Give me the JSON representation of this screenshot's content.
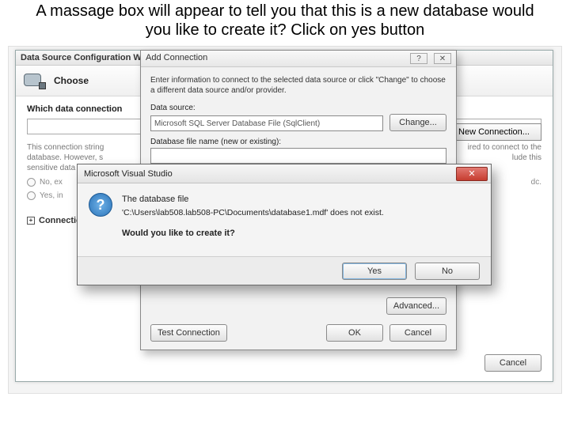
{
  "instruction": "A massage box will appear to tell you that this is a new database would you like to create it? Click on yes button",
  "wizard": {
    "title": "Data Source Configuration Wizard",
    "heading": "Choose",
    "question": "Which data connection",
    "note_left": "This connection string",
    "note_right": "ired to connect to the",
    "note_right2": "lude this",
    "note2": "database. However, s",
    "note3": "sensitive data",
    "radio_no": "No, ex",
    "radio_yes": "Yes, in",
    "expander_label": "Connectio",
    "new_connection_label": "New Connection...",
    "cancel_label": "Cancel",
    "dc_trail": "dc."
  },
  "addconn": {
    "title": "Add Connection",
    "desc": "Enter information to connect to the selected data source or click \"Change\" to choose a different data source and/or provider.",
    "data_source_label": "Data source:",
    "data_source_value": "Microsoft SQL Server Database File (SqlClient)",
    "change_label": "Change...",
    "db_file_label": "Database file name (new or existing):",
    "advanced_label": "Advanced...",
    "test_label": "Test Connection",
    "ok_label": "OK",
    "cancel_label": "Cancel"
  },
  "msg": {
    "title": "Microsoft Visual Studio",
    "line1": "The database file",
    "line2": "'C:\\Users\\lab508.lab508-PC\\Documents\\database1.mdf' does not exist.",
    "ask": "Would you like to create it?",
    "yes_label": "Yes",
    "no_label": "No",
    "close_glyph": "✕"
  }
}
